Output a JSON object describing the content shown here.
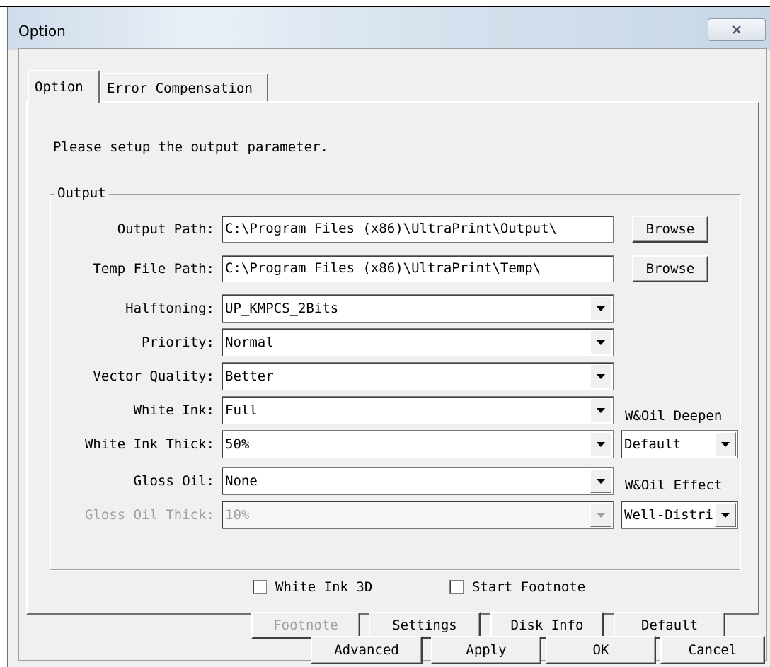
{
  "window": {
    "title": "Option",
    "close_icon": "close-icon"
  },
  "tabs": [
    {
      "label": "Option",
      "active": true
    },
    {
      "label": "Error Compensation",
      "active": false
    }
  ],
  "instruction": "Please setup the output parameter.",
  "group": {
    "legend": "Output",
    "output_path": {
      "label": "Output Path:",
      "value": "C:\\Program Files (x86)\\UltraPrint\\Output\\",
      "browse": "Browse"
    },
    "temp_path": {
      "label": "Temp File Path:",
      "value": "C:\\Program Files (x86)\\UltraPrint\\Temp\\",
      "browse": "Browse"
    },
    "halftoning": {
      "label": "Halftoning:",
      "value": "UP_KMPCS_2Bits"
    },
    "priority": {
      "label": "Priority:",
      "value": "Normal"
    },
    "vector_quality": {
      "label": "Vector Quality:",
      "value": "Better"
    },
    "white_ink": {
      "label": "White Ink:",
      "value": "Full"
    },
    "white_ink_thick": {
      "label": "White Ink Thick:",
      "value": "50%"
    },
    "gloss_oil": {
      "label": "Gloss Oil:",
      "value": "None"
    },
    "gloss_oil_thick": {
      "label": "Gloss Oil Thick:",
      "value": "10%",
      "disabled": true
    },
    "woil_deepen": {
      "label": "W&Oil Deepen",
      "value": "Default"
    },
    "woil_effect": {
      "label": "W&Oil Effect",
      "value": "Well-Distri"
    },
    "white_ink_3d": {
      "label": "White Ink 3D",
      "checked": false
    },
    "start_footnote": {
      "label": "Start Footnote",
      "checked": false
    }
  },
  "panel_buttons": {
    "footnote": "Footnote",
    "settings": "Settings",
    "disk_info": "Disk Info",
    "default": "Default"
  },
  "dialog_buttons": {
    "advanced": "Advanced",
    "apply": "Apply",
    "ok": "OK",
    "cancel": "Cancel"
  }
}
